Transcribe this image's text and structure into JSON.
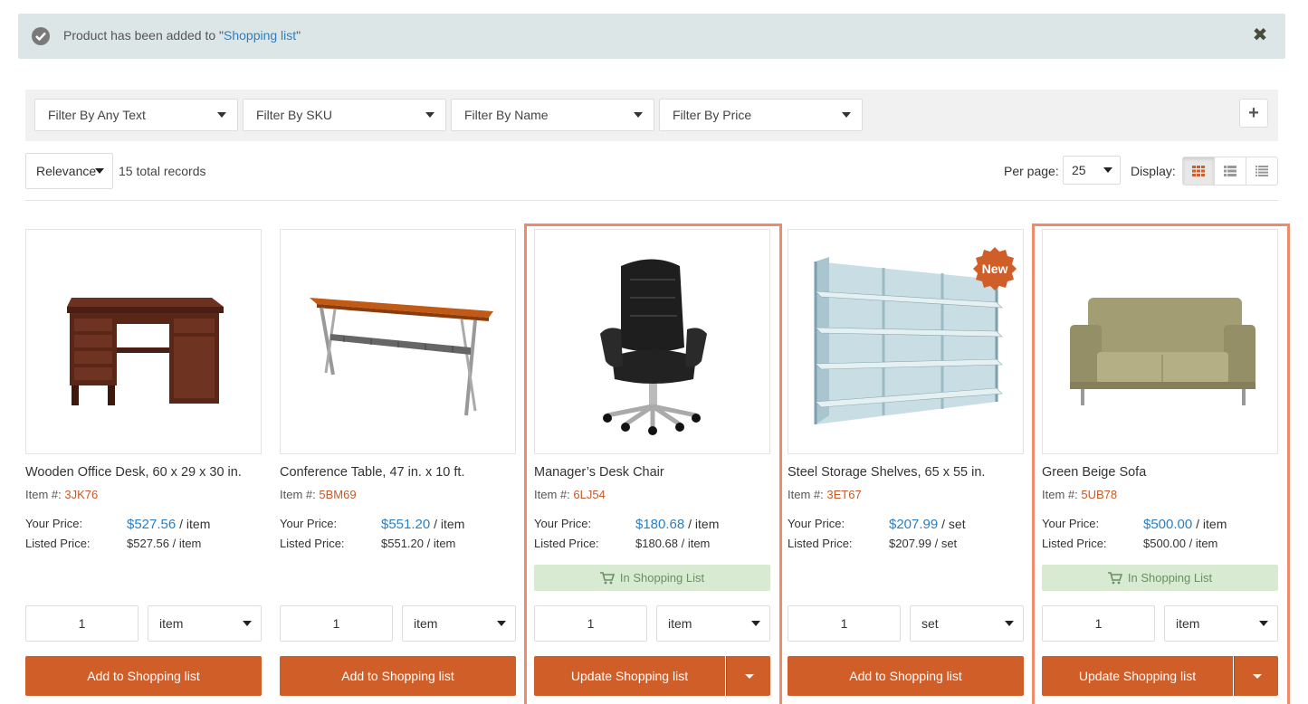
{
  "notification": {
    "prefix": "Product has been added to \"",
    "link": "Shopping list",
    "suffix": "\"",
    "close": "✖"
  },
  "filters": [
    {
      "label": "Filter By Any Text"
    },
    {
      "label": "Filter By SKU"
    },
    {
      "label": "Filter By Name"
    },
    {
      "label": "Filter By Price"
    }
  ],
  "add_filter_label": "+",
  "sort": {
    "selected": "Relevance"
  },
  "records_text": "15 total records",
  "per_page": {
    "label": "Per page:",
    "value": "25"
  },
  "display": {
    "label": "Display:",
    "modes": [
      "grid-view-icon",
      "list-view-icon",
      "compact-view-icon"
    ],
    "active": 0
  },
  "colors": {
    "accent": "#cf5e29",
    "highlight": "#ef8a6a",
    "link": "#2c7fc1",
    "in_list_bg": "#d9ead3"
  },
  "products": [
    {
      "name": "Wooden Office Desk, 60 x 29 x 30 in.",
      "sku_label": "Item #:",
      "sku": "3JK76",
      "your_price_label": "Your Price:",
      "your_price": "$527.56",
      "your_unit": " / item",
      "listed_price_label": "Listed Price:",
      "listed_price": "$527.56 / item",
      "qty": "1",
      "unit": "item",
      "action": "Add to Shopping list",
      "in_list": false,
      "badge": ""
    },
    {
      "name": "Conference Table, 47 in. x 10 ft.",
      "sku_label": "Item #:",
      "sku": "5BM69",
      "your_price_label": "Your Price:",
      "your_price": "$551.20",
      "your_unit": " / item",
      "listed_price_label": "Listed Price:",
      "listed_price": "$551.20 / item",
      "qty": "1",
      "unit": "item",
      "action": "Add to Shopping list",
      "in_list": false,
      "badge": ""
    },
    {
      "name": "Manager’s Desk Chair",
      "sku_label": "Item #:",
      "sku": "6LJ54",
      "your_price_label": "Your Price:",
      "your_price": "$180.68",
      "your_unit": " / item",
      "listed_price_label": "Listed Price:",
      "listed_price": "$180.68 / item",
      "qty": "1",
      "unit": "item",
      "action": "Update Shopping list",
      "in_list": true,
      "in_list_label": "In Shopping List",
      "badge": ""
    },
    {
      "name": "Steel Storage Shelves, 65 x 55 in.",
      "sku_label": "Item #:",
      "sku": "3ET67",
      "your_price_label": "Your Price:",
      "your_price": "$207.99",
      "your_unit": " / set",
      "listed_price_label": "Listed Price:",
      "listed_price": "$207.99 / set",
      "qty": "1",
      "unit": "set",
      "action": "Add to Shopping list",
      "in_list": false,
      "badge": "New"
    },
    {
      "name": "Green Beige Sofa",
      "sku_label": "Item #:",
      "sku": "5UB78",
      "your_price_label": "Your Price:",
      "your_price": "$500.00",
      "your_unit": " / item",
      "listed_price_label": "Listed Price:",
      "listed_price": "$500.00 / item",
      "qty": "1",
      "unit": "item",
      "action": "Update Shopping list",
      "in_list": true,
      "in_list_label": "In Shopping List",
      "badge": ""
    }
  ]
}
